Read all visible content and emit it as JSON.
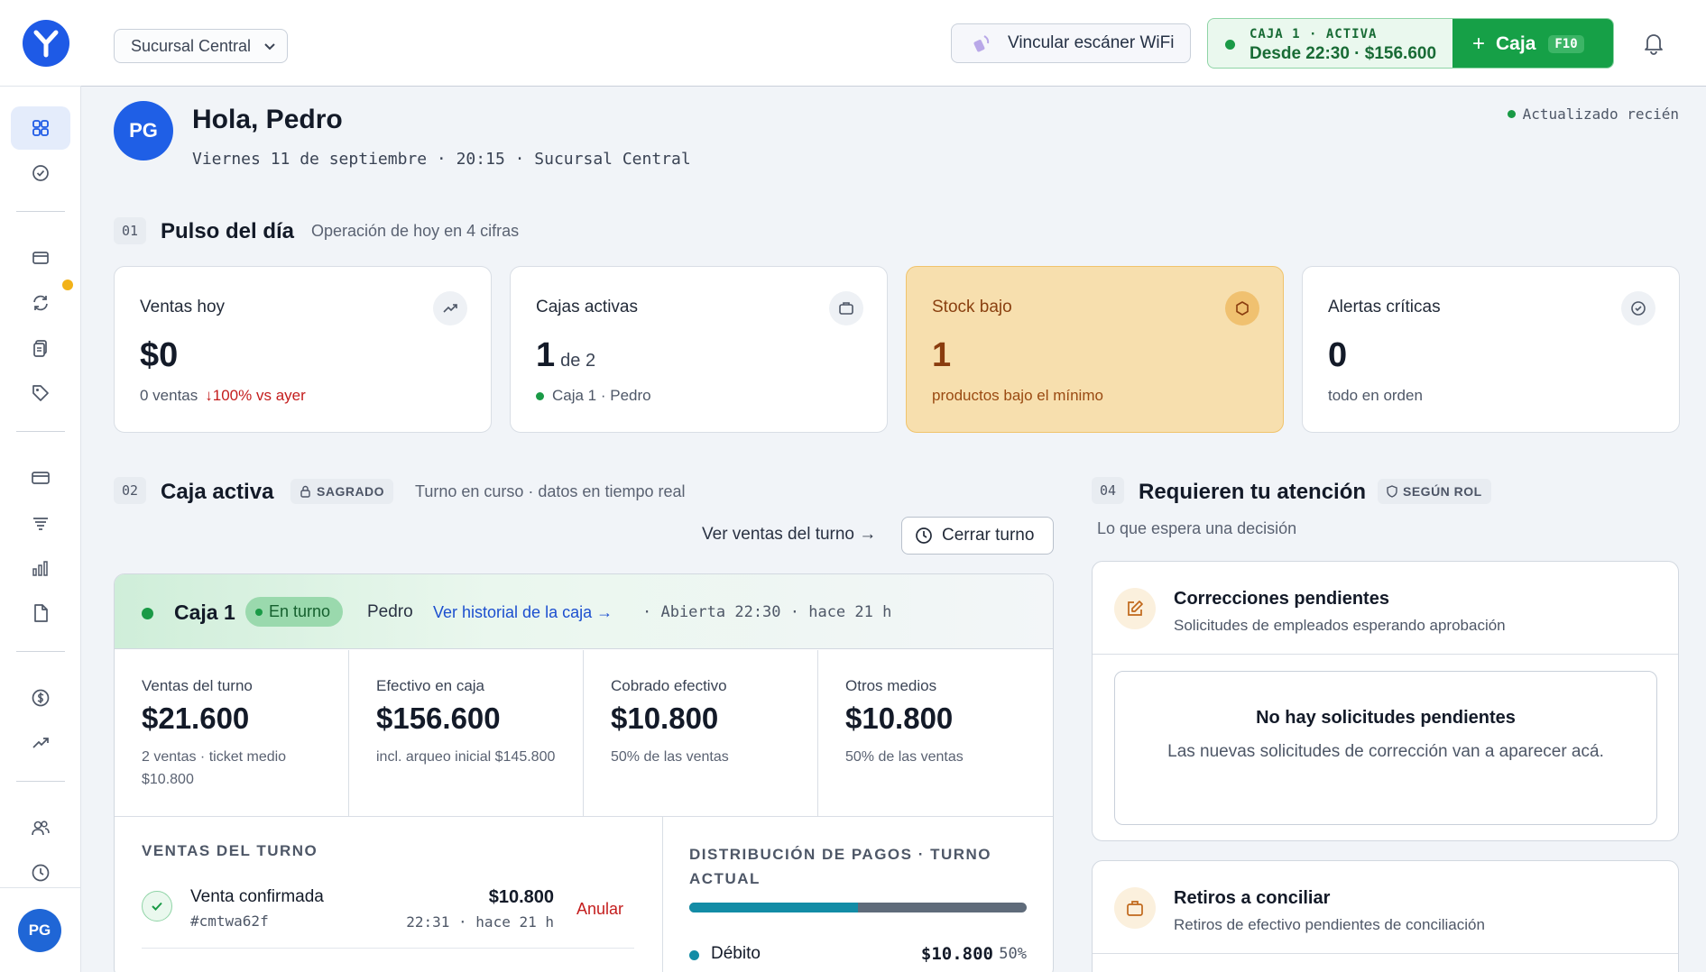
{
  "header": {
    "branch": "Sucursal Central",
    "wifi_label": "Vincular escáner WiFi",
    "caja_status_line1": "CAJA 1 · ACTIVA",
    "caja_status_line2": "Desde 22:30 · $156.600",
    "caja_button": "Caja",
    "caja_shortcut": "F10"
  },
  "sidebar": {
    "avatar": "PG",
    "items": [
      "dashboard-icon",
      "check-circle-icon",
      "register-icon",
      "sync-icon",
      "documents-icon",
      "tag-icon",
      "card-icon",
      "filter-list-icon",
      "bar-chart-icon",
      "file-icon",
      "dollar-icon",
      "trend-icon",
      "users-icon",
      "clock-icon"
    ]
  },
  "greeting": {
    "avatar": "PG",
    "title": "Hola, Pedro",
    "subtitle": "Viernes 11 de septiembre · 20:15 · Sucursal Central",
    "updated": "Actualizado recién"
  },
  "pulse": {
    "num": "01",
    "title": "Pulso del día",
    "subtitle": "Operación de hoy en 4 cifras",
    "cards": [
      {
        "label": "Ventas hoy",
        "value": "$0",
        "foot": "0 ventas",
        "foot_neg": "↓100% vs ayer"
      },
      {
        "label": "Cajas activas",
        "value": "1",
        "value_small": "de 2",
        "foot": "Caja 1 · Pedro"
      },
      {
        "label": "Stock bajo",
        "value": "1",
        "foot": "productos bajo el mínimo"
      },
      {
        "label": "Alertas críticas",
        "value": "0",
        "foot": "todo en orden"
      }
    ]
  },
  "caja_activa": {
    "num": "02",
    "title": "Caja activa",
    "tag": "SAGRADO",
    "subtitle": "Turno en curso · datos en tiempo real",
    "link_ventas": "Ver ventas del turno →",
    "cerrar": "Cerrar turno",
    "name": "Caja 1",
    "badge": "En turno",
    "who": "Pedro",
    "historial": "Ver historial de la caja →",
    "meta": "· Abierta 22:30 · hace 21 h",
    "stats": [
      {
        "label": "Ventas del turno",
        "value": "$21.600",
        "sub": "2 ventas · ticket medio $10.800"
      },
      {
        "label": "Efectivo en caja",
        "value": "$156.600",
        "sub": "incl. arqueo inicial $145.800"
      },
      {
        "label": "Cobrado efectivo",
        "value": "$10.800",
        "sub": "50% de las ventas"
      },
      {
        "label": "Otros medios",
        "value": "$10.800",
        "sub": "50% de las ventas"
      }
    ],
    "ventas_title": "VENTAS DEL TURNO",
    "venta": {
      "title": "Venta confirmada",
      "id": "#cmtwa62f",
      "amount": "$10.800",
      "time": "22:31 · hace 21 h",
      "action": "Anular"
    },
    "dist_title": "DISTRIBUCIÓN DE PAGOS · TURNO ACTUAL",
    "dist_fill_percent": 50,
    "dist_row": {
      "name": "Débito",
      "amount": "$10.800",
      "pct": "50%"
    }
  },
  "attention": {
    "num": "04",
    "title": "Requieren tu atención",
    "tag": "SEGÚN ROL",
    "subtitle": "Lo que espera una decisión",
    "cards": [
      {
        "title": "Correcciones pendientes",
        "subtitle": "Solicitudes de empleados esperando aprobación",
        "empty_title": "No hay solicitudes pendientes",
        "empty_sub": "Las nuevas solicitudes de corrección van a aparecer acá."
      },
      {
        "title": "Retiros a conciliar",
        "subtitle": "Retiros de efectivo pendientes de conciliación"
      }
    ]
  },
  "colors": {
    "brand": "#1e5ae6",
    "success": "#16a047",
    "warn_bg": "#f7dfae",
    "danger": "#c41d1d",
    "teal": "#138ca6"
  }
}
